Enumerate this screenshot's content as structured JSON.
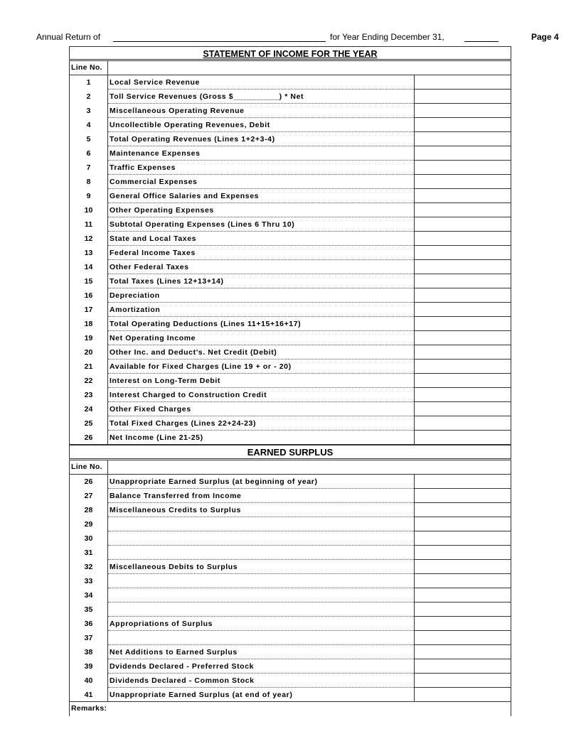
{
  "header": {
    "annual_return_label": "Annual Return of",
    "year_ending_label": "for Year Ending December 31,",
    "page_label": "Page 4"
  },
  "income_statement": {
    "title": "STATEMENT OF INCOME FOR THE YEAR",
    "line_no_header": "Line No.",
    "rows": [
      {
        "line": "1",
        "label": "Local Service Revenue"
      },
      {
        "line": "2",
        "label": "Toll Service Revenues (Gross $__________) * Net"
      },
      {
        "line": "3",
        "label": "Miscellaneous Operating Revenue"
      },
      {
        "line": "4",
        "label": "Uncollectible Operating Revenues, Debit"
      },
      {
        "line": "5",
        "label": "Total Operating Revenues (Lines 1+2+3-4)"
      },
      {
        "line": "6",
        "label": "Maintenance Expenses"
      },
      {
        "line": "7",
        "label": "Traffic Expenses"
      },
      {
        "line": "8",
        "label": "Commercial Expenses"
      },
      {
        "line": "9",
        "label": "General Office Salaries and Expenses"
      },
      {
        "line": "10",
        "label": "Other Operating Expenses"
      },
      {
        "line": "11",
        "label": "Subtotal Operating Expenses (Lines 6 Thru 10)"
      },
      {
        "line": "12",
        "label": "State and Local Taxes"
      },
      {
        "line": "13",
        "label": "Federal Income Taxes"
      },
      {
        "line": "14",
        "label": "Other Federal Taxes"
      },
      {
        "line": "15",
        "label": "Total Taxes (Lines 12+13+14)"
      },
      {
        "line": "16",
        "label": "Depreciation"
      },
      {
        "line": "17",
        "label": "Amortization"
      },
      {
        "line": "18",
        "label": "Total Operating Deductions (Lines 11+15+16+17)"
      },
      {
        "line": "19",
        "label": "Net Operating Income"
      },
      {
        "line": "20",
        "label": "Other Inc. and Deduct's. Net Credit (Debit)"
      },
      {
        "line": "21",
        "label": "Available for Fixed Charges (Line 19 + or - 20)"
      },
      {
        "line": "22",
        "label": "Interest on Long-Term Debit"
      },
      {
        "line": "23",
        "label": "Interest Charged to Construction Credit"
      },
      {
        "line": "24",
        "label": "Other Fixed Charges"
      },
      {
        "line": "25",
        "label": "Total Fixed Charges (Lines 22+24-23)"
      },
      {
        "line": "26",
        "label": "Net Income (Line 21-25)"
      }
    ]
  },
  "earned_surplus": {
    "title": "EARNED SURPLUS",
    "line_no_header": "Line No.",
    "rows": [
      {
        "line": "26",
        "label": "Unappropriate Earned Surplus (at beginning of year)"
      },
      {
        "line": "27",
        "label": "Balance Transferred from Income"
      },
      {
        "line": "28",
        "label": "Miscellaneous Credits to Surplus"
      },
      {
        "line": "29",
        "label": ""
      },
      {
        "line": "30",
        "label": ""
      },
      {
        "line": "31",
        "label": ""
      },
      {
        "line": "32",
        "label": "Miscellaneous Debits to Surplus"
      },
      {
        "line": "33",
        "label": ""
      },
      {
        "line": "34",
        "label": ""
      },
      {
        "line": "35",
        "label": ""
      },
      {
        "line": "36",
        "label": "Appropriations of Surplus"
      },
      {
        "line": "37",
        "label": ""
      },
      {
        "line": "38",
        "label": "Net Additions to Earned Surplus"
      },
      {
        "line": "39",
        "label": "Dvidends Declared - Preferred Stock"
      },
      {
        "line": "40",
        "label": "Dividends Declared - Common Stock"
      },
      {
        "line": "41",
        "label": "Unappropriate Earned Surplus (at end of year)"
      }
    ]
  },
  "remarks_label": "Remarks:"
}
